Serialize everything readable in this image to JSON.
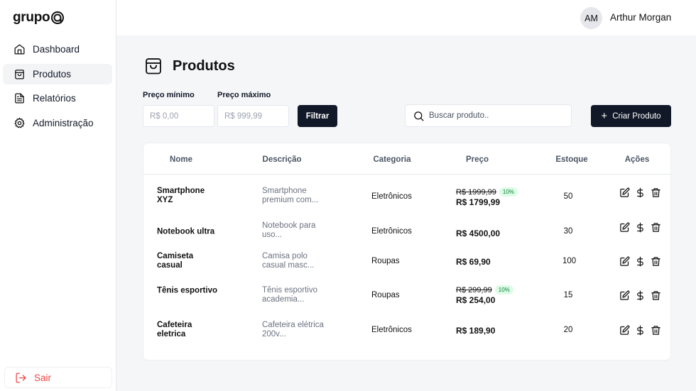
{
  "brand": {
    "logo_text": "grupo"
  },
  "sidebar": {
    "items": [
      {
        "label": "Dashboard",
        "icon": "home-icon"
      },
      {
        "label": "Produtos",
        "icon": "shopping-bag-icon",
        "active": true
      },
      {
        "label": "Relatórios",
        "icon": "file-text-icon"
      },
      {
        "label": "Administração",
        "icon": "gear-icon"
      }
    ],
    "logout_label": "Sair"
  },
  "header": {
    "avatar_initials": "AM",
    "user_name": "Arthur Morgan"
  },
  "page": {
    "title": "Produtos",
    "icon": "shopping-bag-icon"
  },
  "filters": {
    "min_label": "Preço mínimo",
    "min_placeholder": "R$ 0,00",
    "max_label": "Preço máximo",
    "max_placeholder": "R$ 999,99",
    "filter_button": "Filtrar"
  },
  "search": {
    "placeholder": "Buscar produto.."
  },
  "create_button": "Criar Produto",
  "table": {
    "headers": [
      "Nome",
      "Descrição",
      "Categoria",
      "Preço",
      "Estoque",
      "Ações"
    ],
    "rows": [
      {
        "name": "Smartphone XYZ",
        "description": "Smartphone premium com...",
        "category": "Eletrônicos",
        "old_price": "R$ 1999,99",
        "discount": "10%",
        "price": "R$ 1799,99",
        "stock": "50"
      },
      {
        "name": "Notebook ultra",
        "description": "Notebook para uso...",
        "category": "Eletrônicos",
        "old_price": "",
        "discount": "",
        "price": "R$ 4500,00",
        "stock": "30"
      },
      {
        "name": "Camiseta casual",
        "description": "Camisa polo casual masc...",
        "category": "Roupas",
        "old_price": "",
        "discount": "",
        "price": "R$ 69,90",
        "stock": "100"
      },
      {
        "name": "Tênis esportivo",
        "description": "Tênis esportivo academia...",
        "category": "Roupas",
        "old_price": "R$ 299,99",
        "discount": "10%",
        "price": "R$ 254,00",
        "stock": "15"
      },
      {
        "name": "Cafeteira eletrica",
        "description": "Cafeteira elétrica 200v...",
        "category": "Eletrônicos",
        "old_price": "",
        "discount": "",
        "price": "R$ 189,90",
        "stock": "20"
      }
    ],
    "action_icons": [
      "edit-icon",
      "dollar-icon",
      "trash-icon"
    ]
  },
  "colors": {
    "primary": "#111827",
    "danger": "#ef4444",
    "discount_bg": "#dcfce7",
    "discount_text": "#15803d"
  }
}
